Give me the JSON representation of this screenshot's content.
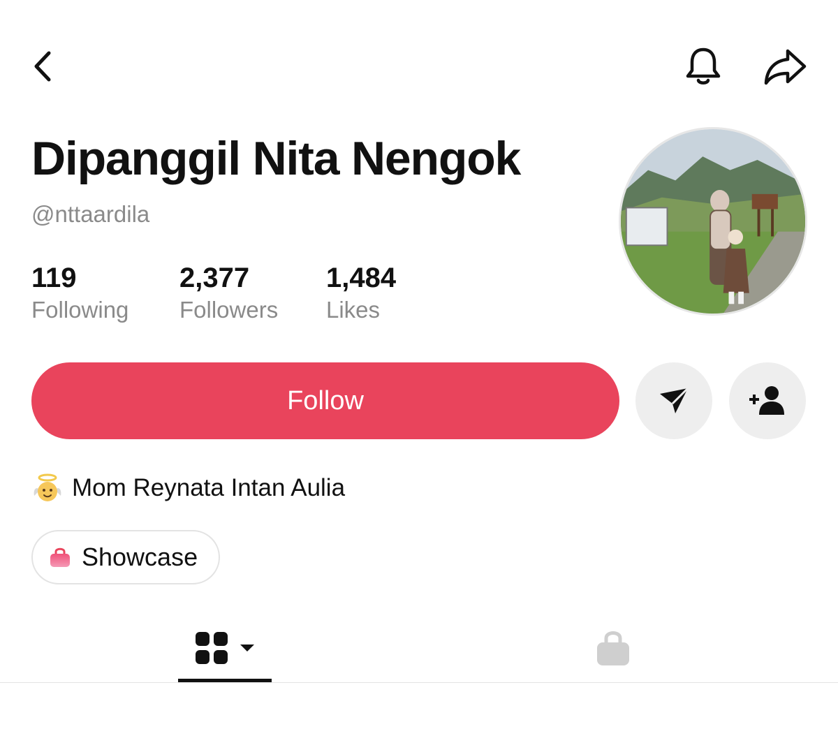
{
  "profile": {
    "display_name": "Dipanggil Nita Nengok",
    "handle": "@nttaardila"
  },
  "stats": [
    {
      "value": "119",
      "label": "Following"
    },
    {
      "value": "2,377",
      "label": "Followers"
    },
    {
      "value": "1,484",
      "label": "Likes"
    }
  ],
  "actions": {
    "follow_label": "Follow"
  },
  "bio": {
    "emoji": "angel-baby-emoji",
    "text": "Mom Reynata Intan Aulia"
  },
  "showcase": {
    "label": "Showcase",
    "icon": "shopping-bag-icon"
  },
  "tabs": [
    {
      "icon": "grid-icon",
      "active": true
    },
    {
      "icon": "shopping-bag-icon",
      "active": false
    }
  ],
  "icons": {
    "back": "chevron-left-icon",
    "bell": "bell-icon",
    "share": "share-arrow-icon",
    "message": "send-icon",
    "add_friend": "add-user-icon"
  },
  "colors": {
    "accent": "#e9445c",
    "text_primary": "#111111",
    "text_secondary": "#8a8a8a",
    "button_gray": "#eeeeee"
  }
}
